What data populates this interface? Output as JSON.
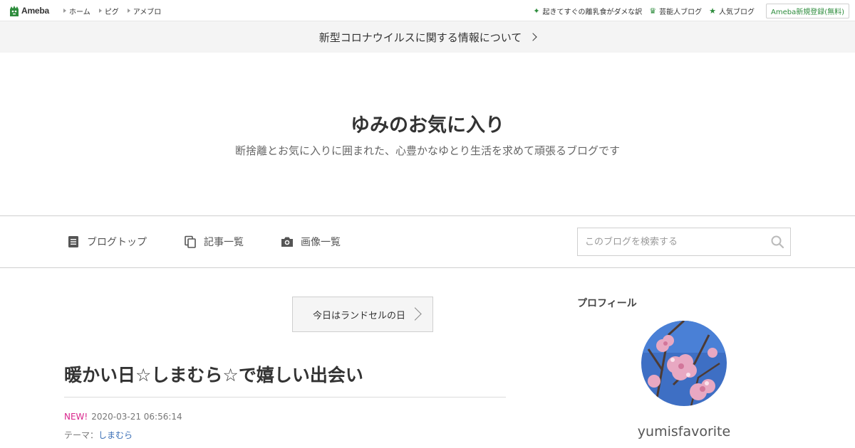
{
  "topbar": {
    "logo": "Ameba",
    "nav": [
      "ホーム",
      "ピグ",
      "アメブロ"
    ],
    "right_links": [
      {
        "label": "起きてすぐの離乳食がダメな訳",
        "icon": "sparkle-icon"
      },
      {
        "label": "芸能人ブログ",
        "icon": "crown-icon"
      },
      {
        "label": "人気ブログ",
        "icon": "star-icon"
      }
    ],
    "signup": "Ameba新規登録(無料)"
  },
  "notice": {
    "text": "新型コロナウイルスに関する情報について"
  },
  "blog": {
    "title": "ゆみのお気に入り",
    "description": "断捨離とお気に入りに囲まれた、心豊かなゆとり生活を求めて頑張るブログです"
  },
  "nav": {
    "items": [
      {
        "label": "ブログトップ",
        "icon": "document-icon"
      },
      {
        "label": "記事一覧",
        "icon": "copy-icon"
      },
      {
        "label": "画像一覧",
        "icon": "camera-icon"
      }
    ],
    "search_placeholder": "このブログを検索する"
  },
  "theme_button": "今日はランドセルの日",
  "post": {
    "title": "暖かい日☆しまむら☆で嬉しい出会い",
    "badge": "NEW!",
    "datetime": "2020-03-21 06:56:14",
    "theme_label": "テーマ：",
    "theme_value": "しまむら"
  },
  "sidebar": {
    "heading": "プロフィール",
    "username": "yumisfavorite"
  },
  "colors": {
    "accent_green": "#2d8c3c",
    "new_badge": "#d9258c",
    "link": "#3b6fb6"
  }
}
